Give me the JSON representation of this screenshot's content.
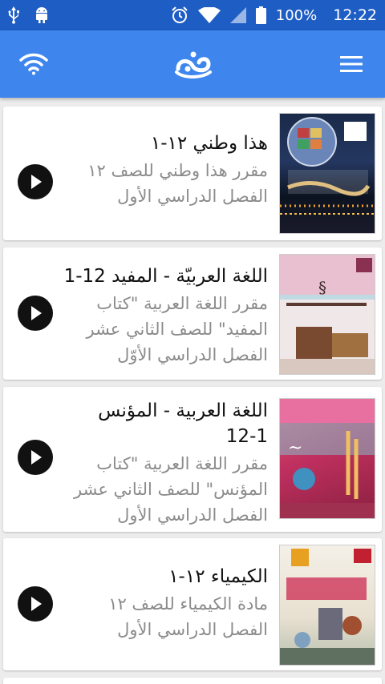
{
  "status_bar": {
    "battery": "100%",
    "time": "12:22",
    "icons": [
      "usb-icon",
      "android-icon",
      "alarm-icon",
      "wifi-signal-icon",
      "cell-signal-icon",
      "battery-icon"
    ]
  },
  "app_bar": {
    "icons": [
      "wifi-icon",
      "app-logo-icon",
      "menu-icon"
    ]
  },
  "items": [
    {
      "title": "هذا وطني ١٢-١",
      "desc_lines": [
        "مقرر هذا وطني للصف ١٢",
        "الفصل الدراسي الأول"
      ]
    },
    {
      "title": "اللغة العربيّة - المفيد 12-1",
      "desc_lines": [
        "مقرر اللغة العربية \"كتاب",
        "المفيد\" للصف الثاني عشر",
        "الفصل الدراسي الأوّل"
      ]
    },
    {
      "title_lines": [
        "اللغة العربية - المؤنس",
        "12-1"
      ],
      "desc_lines": [
        "مقرر اللغة العربية \"كتاب",
        "المؤنس\" للصف الثاني عشر",
        "الفصل الدراسي الأول"
      ]
    },
    {
      "title": "الكيمياء ١٢-١",
      "desc_lines": [
        "مادة الكيمياء للصف ١٢",
        "الفصل الدراسي الأول"
      ]
    }
  ],
  "colors": {
    "status_bar": "#1e5dc4",
    "app_bar": "#3e86ee",
    "background": "#ececec"
  }
}
